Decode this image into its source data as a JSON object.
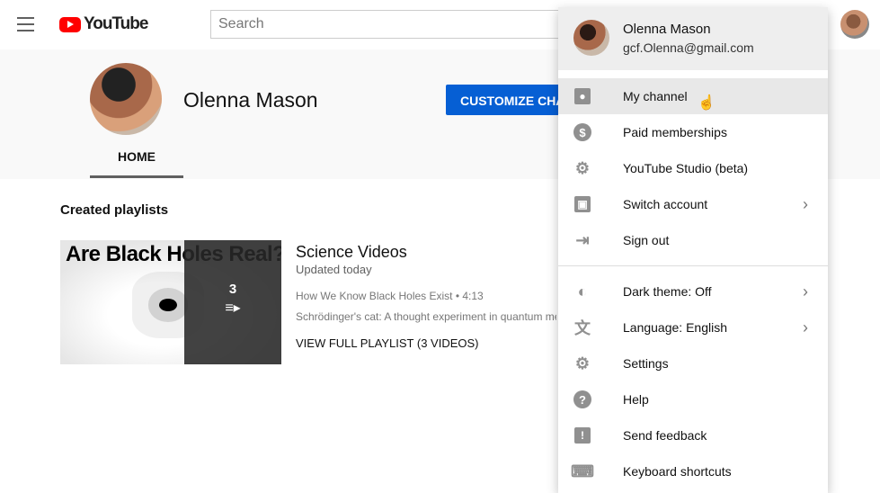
{
  "topbar": {
    "logo": "YouTube",
    "search_placeholder": "Search"
  },
  "channel": {
    "name": "Olenna Mason",
    "customize_label": "CUSTOMIZE CHANNEL",
    "tab_home": "HOME"
  },
  "section": {
    "title": "Created playlists"
  },
  "playlist": {
    "thumb_text": "Are Black Holes Real?",
    "count": "3",
    "title": "Science Videos",
    "updated": "Updated today",
    "videos": [
      "How We Know Black Holes Exist • 4:13",
      "Schrödinger's cat: A thought experiment in quantum mechanics"
    ],
    "view_full": "VIEW FULL PLAYLIST (3 VIDEOS)"
  },
  "menu": {
    "name": "Olenna Mason",
    "email": "gcf.Olenna@gmail.com",
    "items": [
      {
        "label": "My channel",
        "icon": "person-box-icon"
      },
      {
        "label": "Paid memberships",
        "icon": "dollar-icon"
      },
      {
        "label": "YouTube Studio (beta)",
        "icon": "gear-icon"
      },
      {
        "label": "Switch account",
        "icon": "switch-account-icon",
        "chevron": true
      },
      {
        "label": "Sign out",
        "icon": "sign-out-icon"
      },
      {
        "label": "Dark theme: Off",
        "icon": "dark-theme-icon",
        "chevron": true
      },
      {
        "label": "Language: English",
        "icon": "translate-icon",
        "chevron": true
      },
      {
        "label": "Settings",
        "icon": "gear-icon"
      },
      {
        "label": "Help",
        "icon": "help-icon"
      },
      {
        "label": "Send feedback",
        "icon": "feedback-icon"
      },
      {
        "label": "Keyboard shortcuts",
        "icon": "keyboard-icon"
      }
    ]
  },
  "colors": {
    "accent": "#065fd4",
    "logo_red": "#ff0000"
  }
}
